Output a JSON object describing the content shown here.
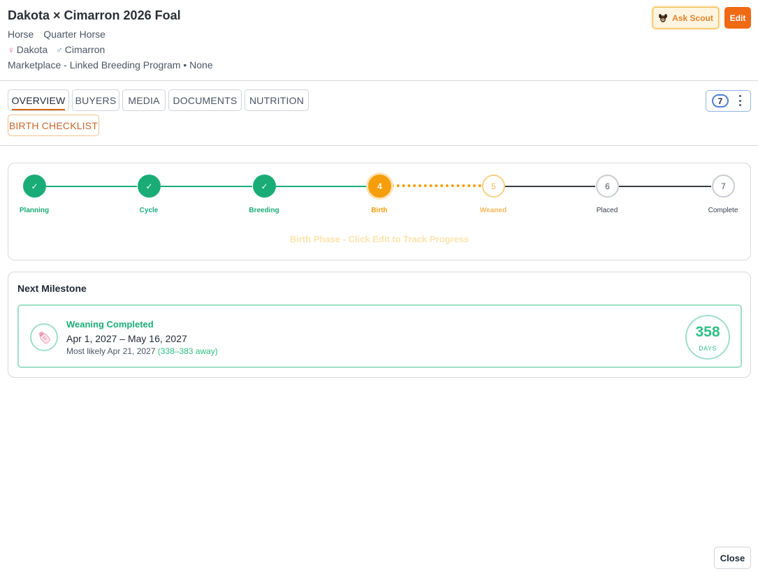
{
  "header": {
    "title": "Dakota × Cimarron 2026 Foal",
    "species": "Horse",
    "breed": "Quarter Horse",
    "dam_symbol": "♀",
    "dam": "Dakota",
    "sire_symbol": "♂",
    "sire": "Cimarron",
    "program_line": "Marketplace - Linked Breeding Program • None",
    "ask_scout_label": "Ask Scout",
    "edit_label": "Edit"
  },
  "tabs": [
    {
      "label": "OVERVIEW",
      "active": true
    },
    {
      "label": "BUYERS",
      "active": false
    },
    {
      "label": "MEDIA",
      "active": false
    },
    {
      "label": "DOCUMENTS",
      "active": false
    },
    {
      "label": "NUTRITION",
      "active": false
    },
    {
      "label": "BIRTH CHECKLIST",
      "active": false
    }
  ],
  "badge_count": "7",
  "progress": {
    "steps": [
      {
        "label": "Planning",
        "number": "1",
        "state": "done"
      },
      {
        "label": "Cycle",
        "number": "2",
        "state": "done"
      },
      {
        "label": "Breeding",
        "number": "3",
        "state": "done"
      },
      {
        "label": "Birth",
        "number": "4",
        "state": "current"
      },
      {
        "label": "Weaned",
        "number": "5",
        "state": "next"
      },
      {
        "label": "Placed",
        "number": "6",
        "state": "todo"
      },
      {
        "label": "Complete",
        "number": "7",
        "state": "todo"
      }
    ],
    "check_symbol": "✓",
    "phase_message": "Birth Phase - Click Edit to Track Progress"
  },
  "milestone": {
    "heading": "Next Milestone",
    "title": "Weaning Completed",
    "range": "Apr 1, 2027 – May 16, 2027",
    "likely_prefix": "Most likely Apr 21, 2027",
    "likely_away": "(338–383 away)",
    "days_value": "358",
    "days_label": "DAYS",
    "icon": "baby-bottle-icon"
  },
  "close_label": "Close",
  "colors": {
    "done": "#1aac77",
    "current": "#f59e0b",
    "accent": "#f06a14",
    "todo": "#c9ccd1"
  }
}
